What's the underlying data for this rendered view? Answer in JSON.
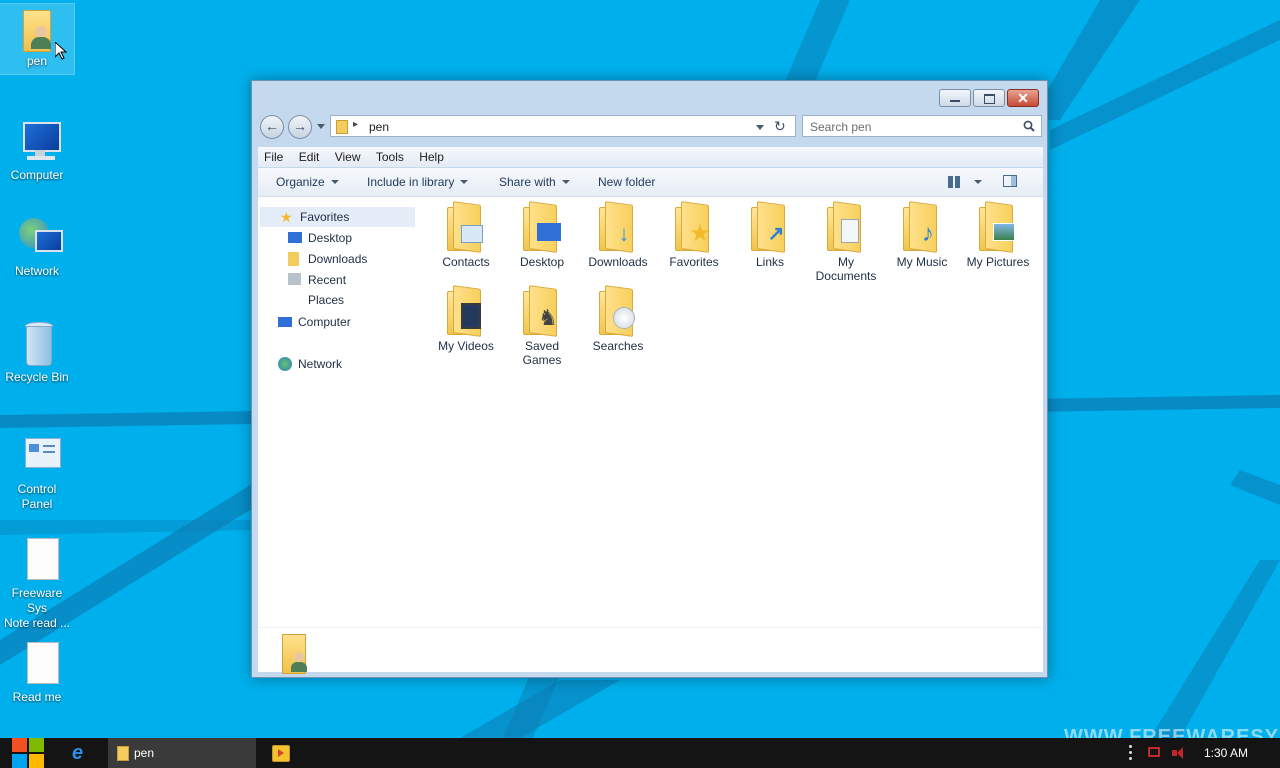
{
  "desktop": {
    "icons": [
      {
        "label": "pen",
        "icon": "user-folder-icon"
      },
      {
        "label": "Computer",
        "icon": "computer-icon"
      },
      {
        "label": "Network",
        "icon": "network-icon"
      },
      {
        "label": "Recycle Bin",
        "icon": "recycle-bin-icon"
      },
      {
        "label": "Control\nPanel",
        "icon": "control-panel-icon"
      },
      {
        "label": "Freeware Sys\nNote read ...",
        "icon": "document-icon"
      },
      {
        "label": "Read me",
        "icon": "document-icon"
      }
    ],
    "watermark": "WWW.FREEWARESYS"
  },
  "window": {
    "address_path": "pen",
    "search_placeholder": "Search pen",
    "menu": [
      "File",
      "Edit",
      "View",
      "Tools",
      "Help"
    ],
    "toolbar": {
      "organize": "Organize",
      "include_in_library": "Include in library",
      "share_with": "Share with",
      "new_folder": "New folder"
    },
    "nav": {
      "favorites": "Favorites",
      "desktop": "Desktop",
      "downloads": "Downloads",
      "recent_places": "Recent Places",
      "computer": "Computer",
      "network": "Network"
    },
    "files": [
      {
        "label": "Contacts",
        "icon": "contacts-folder-icon"
      },
      {
        "label": "Desktop",
        "icon": "desktop-folder-icon"
      },
      {
        "label": "Downloads",
        "icon": "downloads-folder-icon"
      },
      {
        "label": "Favorites",
        "icon": "favorites-folder-icon"
      },
      {
        "label": "Links",
        "icon": "links-folder-icon"
      },
      {
        "label": "My\nDocuments",
        "icon": "documents-folder-icon"
      },
      {
        "label": "My Music",
        "icon": "music-folder-icon"
      },
      {
        "label": "My Pictures",
        "icon": "pictures-folder-icon"
      },
      {
        "label": "My Videos",
        "icon": "videos-folder-icon"
      },
      {
        "label": "Saved\nGames",
        "icon": "saved-games-folder-icon"
      },
      {
        "label": "Searches",
        "icon": "searches-folder-icon"
      }
    ]
  },
  "taskbar": {
    "task_label": "pen",
    "clock": "1:30 AM"
  },
  "colors": {
    "wallpaper": "#00b0ec",
    "taskbar": "#141414",
    "close_button": "#c74b34"
  }
}
